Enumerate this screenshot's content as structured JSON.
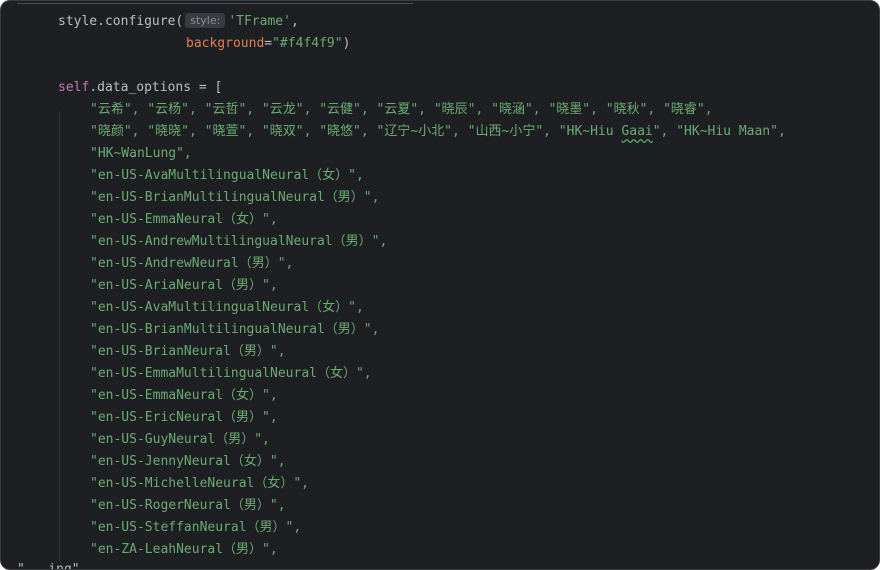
{
  "code": {
    "line1": {
      "prefix": "style.configure(",
      "hint": "style:",
      "arg": "'TFrame'",
      "suffix": ","
    },
    "line2": {
      "param": "background",
      "eq": "=",
      "value": "\"#f4f4f9\"",
      "close": ")"
    },
    "line3": {
      "self": "self",
      "rest": ".data_options = ["
    },
    "list_line1": "\"云希\", \"云杨\", \"云哲\", \"云龙\", \"云健\", \"云夏\", \"晓辰\", \"晓涵\", \"晓墨\", \"晓秋\", \"晓睿\",",
    "list_line2_a": "\"晓颜\", \"晓晓\", \"晓萱\", \"晓双\", \"晓悠\", \"辽宁~小北\", \"山西~小宁\", \"HK~Hiu ",
    "list_line2_squig": "Gaai",
    "list_line2_b": "\", \"HK~Hiu Maan\",",
    "items": [
      "\"HK~WanLung\",",
      "\"en-US-AvaMultilingualNeural（女）\",",
      "\"en-US-BrianMultilingualNeural（男）\",",
      "\"en-US-EmmaNeural（女）\",",
      "\"en-US-AndrewMultilingualNeural（男）\",",
      "\"en-US-AndrewNeural（男）\",",
      "\"en-US-AriaNeural（男）\",",
      "\"en-US-AvaMultilingualNeural（女）\",",
      "\"en-US-BrianMultilingualNeural（男）\",",
      "\"en-US-BrianNeural（男）\",",
      "\"en-US-EmmaMultilingualNeural（女）\",",
      "\"en-US-EmmaNeural（女）\",",
      "\"en-US-EricNeural（男）\",",
      "\"en-US-GuyNeural（男）\",",
      "\"en-US-JennyNeural（女）\",",
      "\"en-US-MichelleNeural（女）\",",
      "\"en-US-RogerNeural（男）\",",
      "\"en-US-SteffanNeural（男）\",",
      "\"en-ZA-LeahNeural（男）\","
    ],
    "bottom_fragment": "\"...ing\""
  }
}
